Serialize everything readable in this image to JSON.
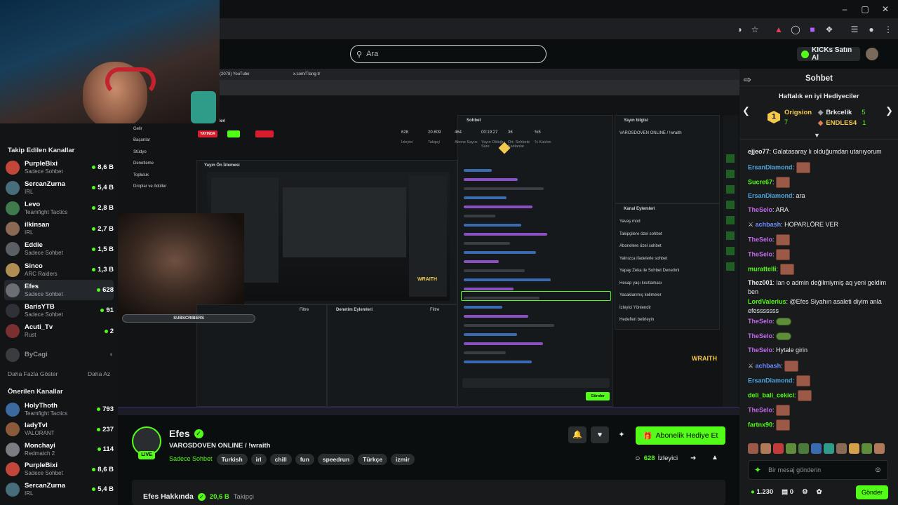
{
  "search": {
    "placeholder": "Ara"
  },
  "header": {
    "kicks_label": "KICKs Satın Al"
  },
  "sidebar": {
    "followed_title": "Takip Edilen Kanallar",
    "followed": [
      {
        "name": "PurpleBixi",
        "category": "Sadece Sohbet",
        "viewers": "8,6 B",
        "color": "#c2473a"
      },
      {
        "name": "SercanZurna",
        "category": "IRL",
        "viewers": "5,4 B",
        "color": "#486d7a"
      },
      {
        "name": "Levo",
        "category": "Teamfight Tactics",
        "viewers": "2,8 B",
        "color": "#3f7a4c"
      },
      {
        "name": "ilkinsan",
        "category": "IRL",
        "viewers": "2,7 B",
        "color": "#8a6a55"
      },
      {
        "name": "Eddie",
        "category": "Sadece Sohbet",
        "viewers": "1,5 B",
        "color": "#5a5f66"
      },
      {
        "name": "Sinco",
        "category": "ARC Raiders",
        "viewers": "1,3 B",
        "color": "#b08d52"
      },
      {
        "name": "Efes",
        "category": "Sadece Sohbet",
        "viewers": "628",
        "color": "#6b6e72"
      },
      {
        "name": "BarisYTB",
        "category": "Sadece Sohbet",
        "viewers": "91",
        "color": "#2e3135"
      },
      {
        "name": "Acuti_Tv",
        "category": "Rust",
        "viewers": "2",
        "color": "#7a3030"
      }
    ],
    "offline_name": "ByCagi",
    "show_more": "Daha Fazla Göster",
    "show_less": "Daha Az",
    "recommended_title": "Önerilen Kanallar",
    "recommended": [
      {
        "name": "HolyThoth",
        "category": "Teamfight Tactics",
        "viewers": "793",
        "color": "#3b6aa0"
      },
      {
        "name": "ladyTvl",
        "category": "VALORANT",
        "viewers": "237",
        "color": "#8a5a3a"
      },
      {
        "name": "Monchayi",
        "category": "Redmatch 2",
        "viewers": "114",
        "color": "#7a7d82"
      },
      {
        "name": "PurpleBixi",
        "category": "Sadece Sohbet",
        "viewers": "8,6 B",
        "color": "#c2473a"
      },
      {
        "name": "SercanZurna",
        "category": "IRL",
        "viewers": "5,4 B",
        "color": "#486d7a"
      }
    ]
  },
  "stream_info": {
    "name": "Efes",
    "title": "VAROSDOVEN ONLINE / !wraith",
    "category": "Sadece Sohbet",
    "tags": [
      "Turkish",
      "irl",
      "chill",
      "fun",
      "speedrun",
      "Türkçe",
      "izmir"
    ],
    "live_label": "LIVE",
    "gift_button": "Abonelik Hediye Et",
    "viewers": "628",
    "viewers_label": "İzleyici",
    "about_title": "Efes Hakkında",
    "followers": "20,6 B",
    "followers_label": "Takipçi"
  },
  "chat": {
    "title": "Sohbet",
    "top_gifters_title": "Haftalık en iyi Hediyeciler",
    "gifters": [
      {
        "rank": "1",
        "name": "Origsion",
        "count": "7"
      },
      {
        "name": "Brkcelik",
        "count": "5"
      },
      {
        "name": "ENDLES4",
        "count": "1"
      }
    ],
    "messages": [
      {
        "user": "ejjeo77",
        "text": ": Galatasaray lı olduğumdan utanıyorum",
        "color": "#e8eaed"
      },
      {
        "user": "ErsanDiamond",
        "text": ":",
        "color": "#4aa3df",
        "emote": "red"
      },
      {
        "user": "Sucre67",
        "text": ":",
        "color": "#53fc18",
        "emote": "red"
      },
      {
        "user": "ErsanDiamond",
        "text": ": ara",
        "color": "#4aa3df"
      },
      {
        "user": "TheSelo",
        "text": ": ARA",
        "color": "#c06ae8"
      },
      {
        "user": "achbash",
        "text": ": HOPARLÖRE VER",
        "color": "#6f8cff"
      },
      {
        "user": "TheSelo",
        "text": ":",
        "color": "#c06ae8",
        "emote": "red"
      },
      {
        "user": "TheSelo",
        "text": ":",
        "color": "#c06ae8",
        "emote": "red"
      },
      {
        "user": "murattelli",
        "text": ":",
        "color": "#53fc18",
        "emote": "red"
      },
      {
        "user": "Thez001",
        "text": ": lan o admin değilmiymiş aq yeni geldim ben",
        "color": "#e8eaed"
      },
      {
        "user": "LordValerius",
        "text": ": @Efes Siyahın asaleti diyim anla efesssssss",
        "color": "#53fc18"
      },
      {
        "user": "TheSelo",
        "text": ":",
        "color": "#c06ae8",
        "emote": "green"
      },
      {
        "user": "TheSelo",
        "text": ":",
        "color": "#c06ae8",
        "emote": "green"
      },
      {
        "user": "TheSelo",
        "text": ": Hytale girin",
        "color": "#c06ae8"
      },
      {
        "user": "achbash",
        "text": ":",
        "color": "#6f8cff",
        "emote": "red"
      },
      {
        "user": "ErsanDiamond",
        "text": ":",
        "color": "#4aa3df",
        "emote": "red"
      },
      {
        "user": "deli_bali_cekici",
        "text": ":",
        "color": "#53fc18",
        "emote": "red"
      },
      {
        "user": "TheSelo",
        "text": ":",
        "color": "#c06ae8",
        "emote": "red"
      },
      {
        "user": "fartnx90",
        "text": ":",
        "color": "#53fc18",
        "emote": "red"
      }
    ],
    "input_placeholder": "Bir mesaj gönderin",
    "points": "1.230",
    "chests": "0",
    "send_button": "Gönder"
  },
  "inner_screen": {
    "tab1": "(2078) YouTube",
    "tab2": "x.com/Tlang-tr",
    "stats_title": "İstatistikleri",
    "live_badge": "YAYINDA",
    "stat_values": [
      "628",
      "20.609",
      "464",
      "00:19:27",
      "36",
      "%5"
    ],
    "stat_labels": [
      "İzleyici",
      "Takipçi",
      "Abone Sayısı",
      "Yayın Olduğu Süre",
      "Ort. Sohbete Katılanlar",
      "% Katılım"
    ],
    "menu_items": [
      "Yayın Bağlantısı ve Anahtarı",
      "Gelir",
      "Başarılar",
      "Stüdyo",
      "Denetleme",
      "Topluluk",
      "Droplar ve ödüller"
    ],
    "preview_title": "Yayın Ön İzlemesi",
    "chat_title": "Sohbet",
    "info_title": "Yayın bilgisi",
    "info_stream": "VAROSDOVEN ONLINE / !wraith",
    "channel_actions_title": "Kanal Eylemleri",
    "channel_actions": [
      "Yavaş mod",
      "Takipçilere özel sohbet",
      "Abonelere özel sohbet",
      "Yalnızca ifadelerle sohbet",
      "Yapay Zeka ile Sohbet Denetimi",
      "Hesap yaşı kısıtlaması",
      "Yasaklanmış kelimeler",
      "İzleyici Yönlendir",
      "Hedefleri belirleyin"
    ],
    "moderation_title": "Denetim Eylemleri",
    "filter_label": "Filtre",
    "subscribers_label": "SUBSCRIBERS",
    "wraith": "WRAITH",
    "send_label": "Gönder"
  }
}
